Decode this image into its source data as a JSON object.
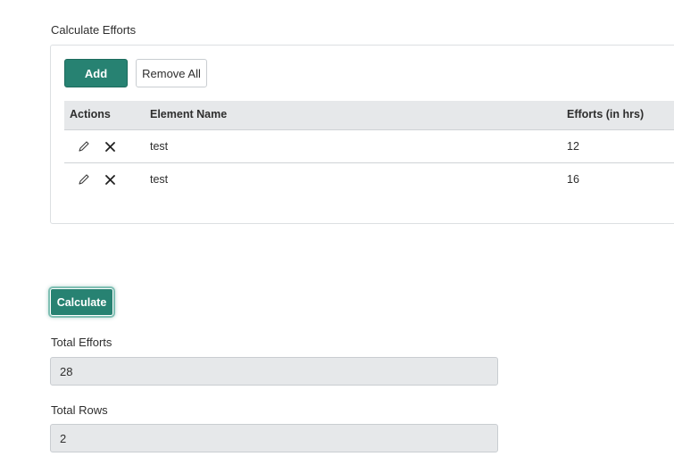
{
  "section": {
    "title": "Calculate Efforts"
  },
  "toolbar": {
    "add_label": "Add",
    "remove_all_label": "Remove All"
  },
  "table": {
    "headers": {
      "actions": "Actions",
      "element_name": "Element Name",
      "efforts": "Efforts (in hrs)"
    },
    "rows": [
      {
        "element_name": "test",
        "efforts": "12"
      },
      {
        "element_name": "test",
        "efforts": "16"
      }
    ],
    "row_icons": [
      "pencil-icon",
      "close-icon"
    ]
  },
  "calculate": {
    "label": "Calculate"
  },
  "totals": {
    "efforts_label": "Total Efforts",
    "efforts_value": "28",
    "rows_label": "Total Rows",
    "rows_value": "2"
  },
  "colors": {
    "primary": "#278272",
    "header_bg": "#e6e8ea",
    "readonly_bg": "#e6e8ea"
  }
}
